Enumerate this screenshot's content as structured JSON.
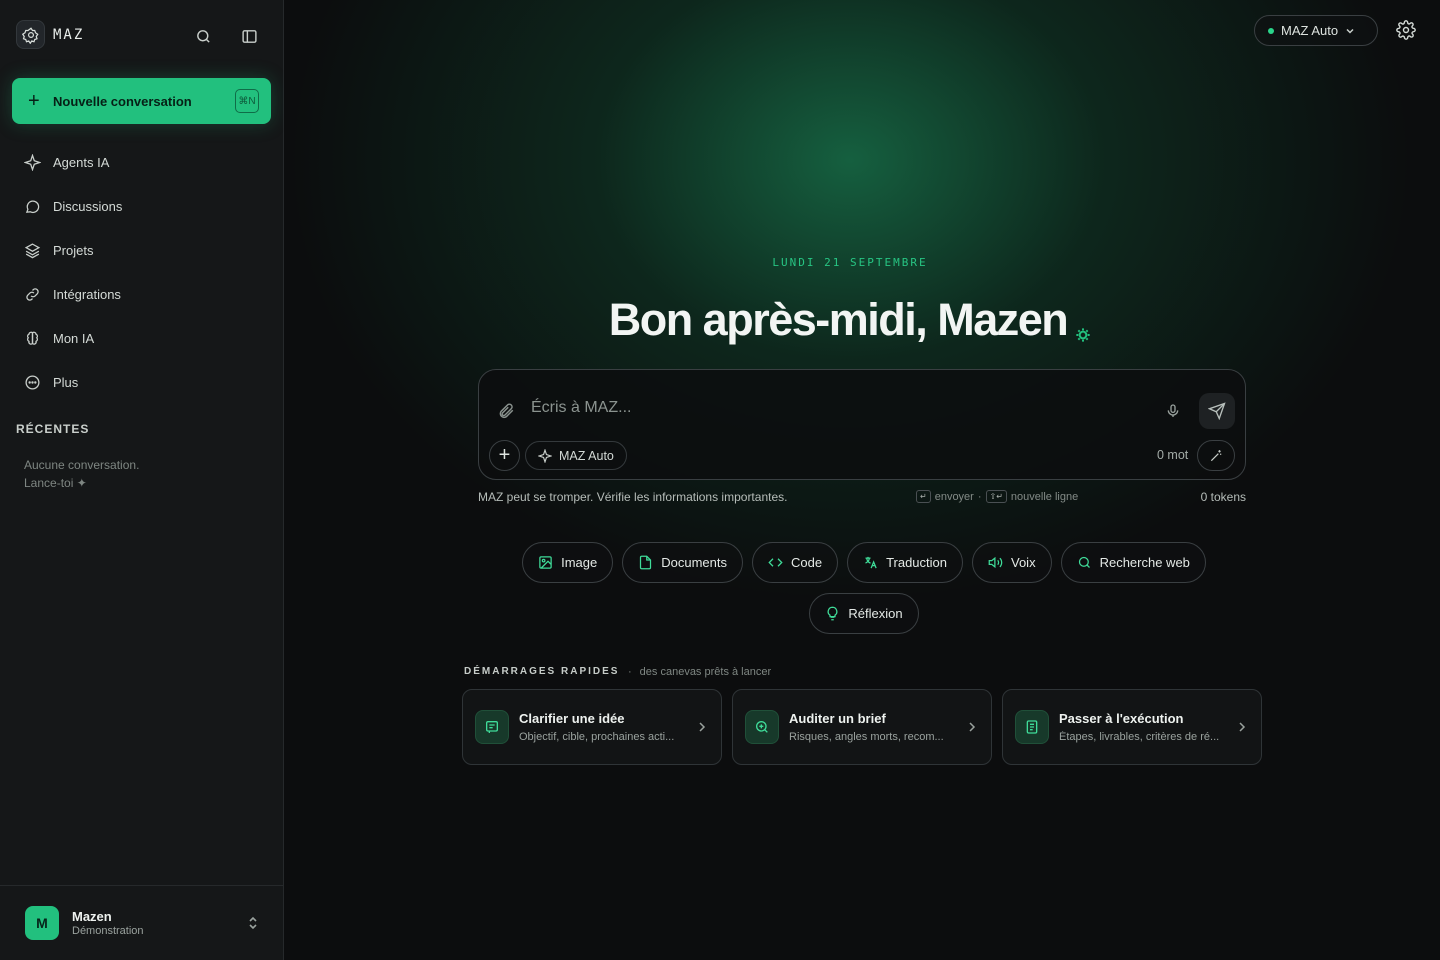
{
  "colors": {
    "accent": "#22c07e",
    "background": "#0c0d0e",
    "sidebar": "#151718"
  },
  "sidebar": {
    "brand": "MAZ",
    "icons": [
      "search-icon",
      "sidebar-toggle-icon"
    ],
    "new_conversation": {
      "label": "Nouvelle conversation",
      "shortcut": "⌘N"
    },
    "items": [
      {
        "label": "Agents IA",
        "icon": "sparkle-icon"
      },
      {
        "label": "Discussions",
        "icon": "chat-bubble-icon"
      },
      {
        "label": "Projets",
        "icon": "layers-icon"
      },
      {
        "label": "Intégrations",
        "icon": "link-icon"
      },
      {
        "label": "Mon IA",
        "icon": "brain-icon"
      },
      {
        "label": "Plus",
        "icon": "more-circle-icon"
      }
    ],
    "recent_title": "RÉCENTES",
    "recent_empty_line1": "Aucune conversation.",
    "recent_empty_line2": "Lance-toi ✦",
    "user": {
      "initial": "M",
      "name": "Mazen",
      "subtitle": "Démonstration"
    }
  },
  "header": {
    "model_label": "MAZ Auto"
  },
  "main": {
    "date": "LUNDI 21 SEPTEMBRE",
    "greeting": "Bon après-midi, Mazen",
    "composer": {
      "placeholder": "Écris à MAZ...",
      "model_chip": "MAZ Auto",
      "word_count": "0 mot"
    },
    "disclaimer": "MAZ peut se tromper. Vérifie les informations importantes.",
    "hint_send_key": "↵",
    "hint_send": "envoyer",
    "hint_separator": "·",
    "hint_newline_key": "⇧↵",
    "hint_newline": "nouvelle ligne",
    "tokens": "0 tokens",
    "chips": [
      {
        "label": "Image",
        "icon": "image-icon"
      },
      {
        "label": "Documents",
        "icon": "document-icon"
      },
      {
        "label": "Code",
        "icon": "code-icon"
      },
      {
        "label": "Traduction",
        "icon": "translate-icon"
      },
      {
        "label": "Voix",
        "icon": "speaker-icon"
      },
      {
        "label": "Recherche web",
        "icon": "search-icon"
      },
      {
        "label": "Réflexion",
        "icon": "lightbulb-icon"
      }
    ],
    "quick_title": "DÉMARRAGES RAPIDES",
    "quick_sep": "·",
    "quick_subtitle": "des canevas prêts à lancer",
    "cards": [
      {
        "title": "Clarifier une idée",
        "subtitle": "Objectif, cible, prochaines acti...",
        "icon": "note-icon"
      },
      {
        "title": "Auditer un brief",
        "subtitle": "Risques, angles morts, recom...",
        "icon": "zoom-icon"
      },
      {
        "title": "Passer à l'exécution",
        "subtitle": "Étapes, livrables, critères de ré...",
        "icon": "checklist-icon"
      }
    ]
  }
}
